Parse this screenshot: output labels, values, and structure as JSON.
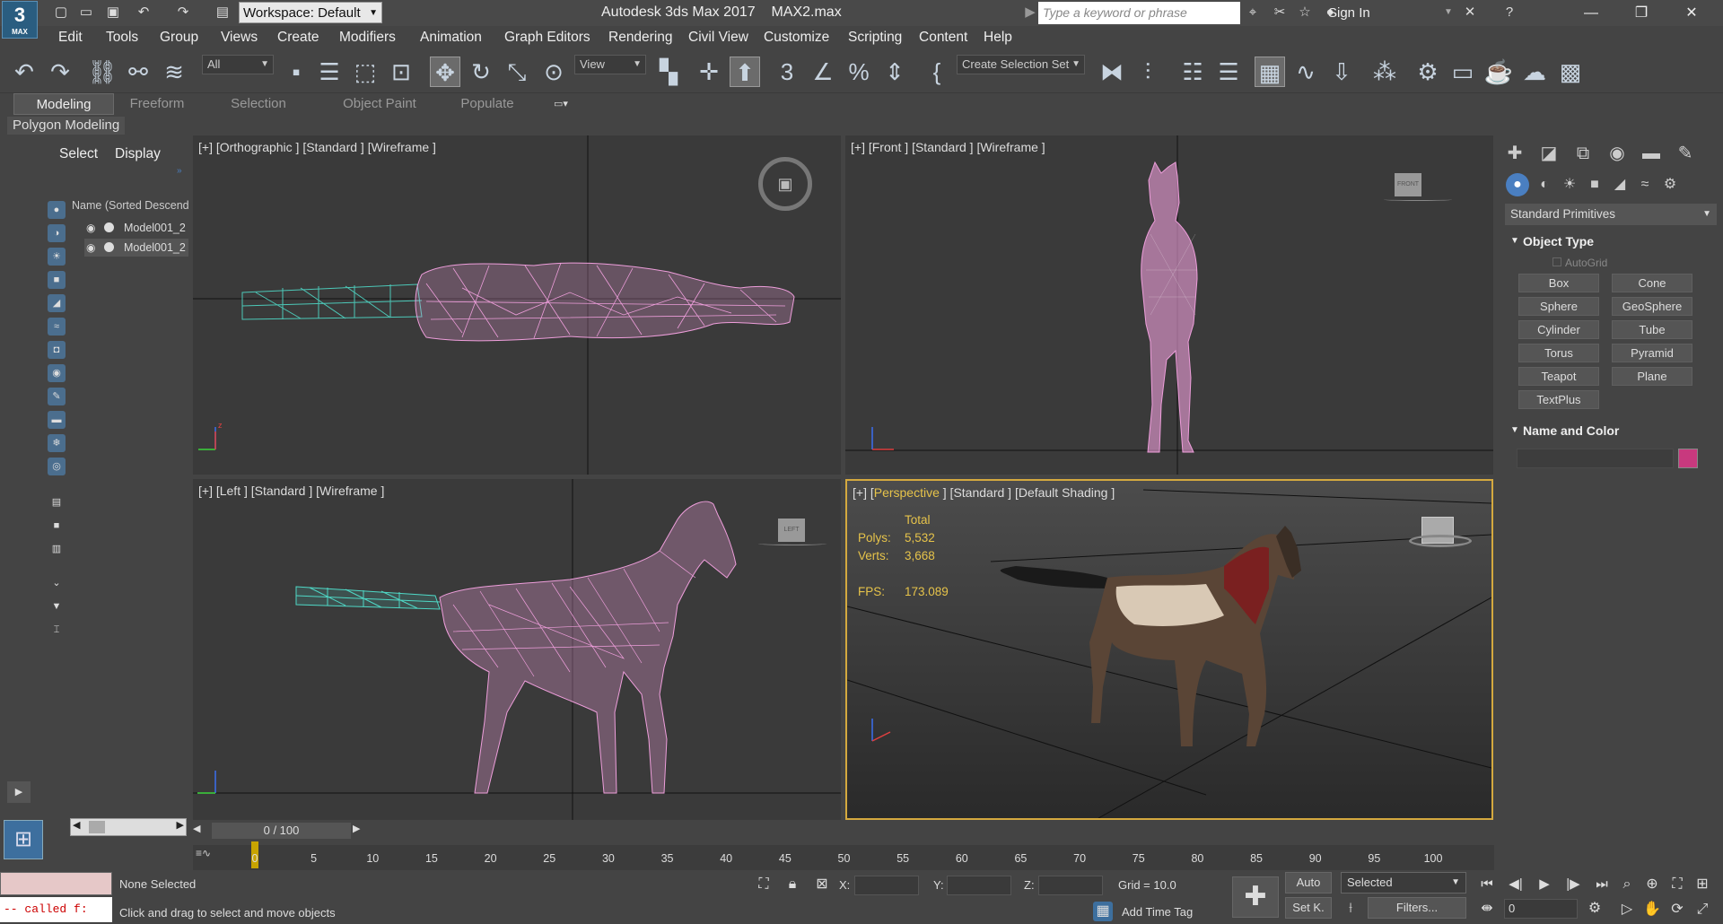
{
  "app": {
    "title": "Autodesk 3ds Max 2017",
    "file": "MAX2.max",
    "logo_text": "3",
    "logo_sub": "MAX",
    "workspace": "Workspace: Default",
    "search_placeholder": "Type a keyword or phrase",
    "signin": "Sign In"
  },
  "menu": [
    "Edit",
    "Tools",
    "Group",
    "Views",
    "Create",
    "Modifiers",
    "Animation",
    "Graph Editors",
    "Rendering",
    "Civil View",
    "Customize",
    "Scripting",
    "Content",
    "Help"
  ],
  "toolbar": {
    "filter": "All",
    "refcoord": "View",
    "selection_set": "Create Selection Set"
  },
  "ribbon": {
    "tabs": [
      "Modeling",
      "Freeform",
      "Selection",
      "Object Paint",
      "Populate"
    ],
    "active": "Modeling",
    "panel": "Polygon Modeling"
  },
  "explorer": {
    "tabs": [
      "Select",
      "Display"
    ],
    "header": "Name (Sorted Descending)",
    "rows": [
      "Model001_2",
      "Model001_2"
    ]
  },
  "viewports": {
    "top_left": {
      "label": "[+] [Orthographic ] [Standard ] [Wireframe ]"
    },
    "top_right": {
      "label": "[+] [Front ] [Standard ] [Wireframe ]",
      "cube": "FRONT"
    },
    "bottom_left": {
      "label": "[+] [Left ] [Standard ] [Wireframe ]",
      "cube": "LEFT"
    },
    "bottom_right": {
      "label_pre": "[+] [",
      "label_view": "Perspective",
      "label_post": " ] [Standard ] [Default Shading ]",
      "stats_total": "Total",
      "polys_label": "Polys:",
      "polys": "5,532",
      "verts_label": "Verts:",
      "verts": "3,668",
      "fps_label": "FPS:",
      "fps": "173.089"
    }
  },
  "command_panel": {
    "category": "Standard Primitives",
    "object_type": "Object Type",
    "autogrid": "AutoGrid",
    "primitives": [
      "Box",
      "Cone",
      "Sphere",
      "GeoSphere",
      "Cylinder",
      "Tube",
      "Torus",
      "Pyramid",
      "Teapot",
      "Plane",
      "TextPlus"
    ],
    "name_color": "Name and Color",
    "swatch": "#c8397e"
  },
  "timeline": {
    "frame": "0 / 100",
    "ticks": [
      "0",
      "5",
      "10",
      "15",
      "20",
      "25",
      "30",
      "35",
      "40",
      "45",
      "50",
      "55",
      "60",
      "65",
      "70",
      "75",
      "80",
      "85",
      "90",
      "95",
      "100"
    ]
  },
  "status": {
    "script_output": "-- called f:",
    "selection": "None Selected",
    "prompt": "Click and drag to select and move objects",
    "x_label": "X:",
    "y_label": "Y:",
    "z_label": "Z:",
    "grid": "Grid = 10.0",
    "add_time_tag": "Add Time Tag",
    "auto": "Auto",
    "set_key": "Set K.",
    "selected": "Selected",
    "filters": "Filters...",
    "frame_field": "0"
  },
  "colors": {
    "wire_pink": "#ee9edb",
    "wire_cyan": "#4fd8c6",
    "active_border": "#d4a93f",
    "stats_text": "#e6c34a"
  }
}
